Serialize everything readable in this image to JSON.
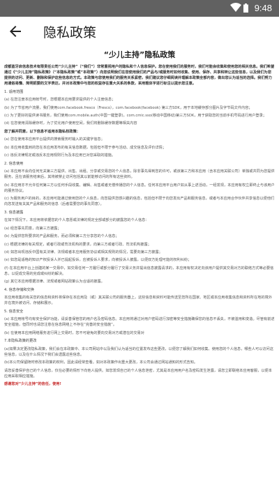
{
  "status_bar": {
    "time": "9:48"
  },
  "app_bar": {
    "title": "隐私政策"
  },
  "document": {
    "title": "“少儿主持”隐私政策",
    "paragraphs": [
      {
        "style": "bold",
        "text": "成都蓝牙启信息技术有限责任公司“少儿主持”（“我们”）非常重视用户的隐私和个人信息保护。您在使用我们的服务时，我们可能会收集和使用您的相关信息。我们希望通过《“少儿主持”隐私政策》（“本隐私政策”或“本政策”）向您说明我们在您使用我们的产品与/或服务时如何收集、使用、保存、共享和转让这些信息，以及我们为您提供的访问、更新、删除和保护这些信息的方式。本政策与您使用我们的服务关系紧密，我们建议您仔细阅读并理解本政策全部内容，做出您认为适当的选择。我们努力用通俗易懂、简明扼要的文字表达，并对本政策中与您的权益存在重大关系的条款，采用粗体字进行标注以提示您注意。"
      },
      {
        "style": "heading",
        "text": "1. 适用范围"
      },
      {
        "style": "normal",
        "text": "(a) 在您注册本应用帐号时，您根据本应用要求提供的个人注册信息；"
      },
      {
        "style": "normal",
        "text": "(b) 为了节省用户流量，我们使用com.facebook.fresco（Fresco），com.facebook(facebook) 第三方SDK，用于本地缓存部分图片及字节码文件内容；"
      },
      {
        "style": "normal",
        "text": "(c) 为了更好的提供读书服务，我们使用com.mobile.auth(中国一键登录)，com.cmic.sso(移动中国移动)第三方SDK，用于获取您的当前手机号码进行用户登录；"
      },
      {
        "style": "normal",
        "text": "(d) 在您使用清除缓存时，为了优化用户使用空间，我们将删除缓存数据等相关内容"
      },
      {
        "style": "bold",
        "text": "您了解并同意，以下信息不适用本隐私权政策："
      },
      {
        "style": "normal",
        "text": "(a) 您在使用本应用平台提供的搜索服务时输入的关键字信息；"
      },
      {
        "style": "normal",
        "text": "(b) 本应用收集到的您在本应用发布的有关信息数据，包括但不限于参与活动、成交信息及评价详情；"
      },
      {
        "style": "normal",
        "text": "(c) 违反法律规定或违反本应用规则行为及本应用已对您采取的措施。"
      },
      {
        "style": "heading",
        "text": "2. 信息使用"
      },
      {
        "style": "normal",
        "text": "(a) 本应用不会向任何无关第三方提供、出售、出租、分享或交易您的个人信息，除非事先得到您的许可，或该第三方和本应用（含本应用关联公司）单独或共同为您提供服务，且在该服务结束后，其将被禁止访问包括其以前能够访问的所有这些资料。"
      },
      {
        "style": "normal",
        "text": "(b) 本应用亦不允许任何第三方以任何手段收集、编辑、出售或者无偿传播您的个人信息。任何本应用平台用户如从事上述活动，一经发现，本应用有权立即终止与该用户的服务协议。"
      },
      {
        "style": "normal",
        "text": "(c) 为服务用户的目的，本应用可能通过使用您的个人信息，向您提供您感兴趣的信息，包括但不限于向您发出产品和服务信息，或者与本应用合作伙伴共享信息以便他们向您发送有关其产品和服务的信息（后者需要您的事先同意）。"
      },
      {
        "style": "heading",
        "text": "3. 信息披露"
      },
      {
        "style": "normal",
        "text": "在如下情况下，本应用将依据您的个人意愿或法律的规定全部或部分的披露您的个人信息："
      },
      {
        "style": "normal",
        "text": "(a) 经您事先同意，向第三方披露；"
      },
      {
        "style": "normal",
        "text": "(b) 为提供您所要求的产品和服务，而必须和第三方分享您的个人信息；"
      },
      {
        "style": "normal",
        "text": "(c) 根据法律的有关规定，或者行政或司法机构的要求，向第三方或者行政、司法机构披露；"
      },
      {
        "style": "normal",
        "text": "(d) 如您出现违反中国有关法律、法规或者本应用服务协议或相关规则的情况，需要向第三方披露；"
      },
      {
        "style": "normal",
        "text": "(e) 如您是适格的知识产权投诉人并已提起投诉，应被投诉人要求，向被投诉人披露，以便双方处理可能的权利纠纷；"
      },
      {
        "style": "normal",
        "text": "(f) 在本应用平台上创建的某一交易中，如交易任何一方履行或部分履行了交易义务并提出信息披露请求的，本应用有权决定向该用户提供其交易对方的联络方式等必要信息，以促成交易的完成或纠纷的解决。"
      },
      {
        "style": "normal",
        "text": "(g) 其它本应用根据法律、法规或者网站政策认为合适的披露。"
      },
      {
        "style": "heading",
        "text": "4. 信息存储和交换"
      },
      {
        "style": "normal",
        "text": "本应用收集的有关您的信息和资料将保存在本应用及（或）其关联公司的服务器上，这些信息和资料可能传送至您所在国家、地区或本应用收集信息和资料所在地的境外并在境外被访问、存储和展示。"
      },
      {
        "style": "heading",
        "text": "5. 信息安全"
      },
      {
        "style": "normal",
        "text": "(a) 本应用帐号均有安全保护功能，请妥善保管您的用户名及密码信息。本应用将通过对用户密码进行加密等安全措施确保您的信息不丢失，不被滥用和变造。尽管有前述安全措施，但同时也请您注意在信息网络上不存在“完善的安全措施”。"
      },
      {
        "style": "normal",
        "text": "(b) 在使用本应用网络服务进行网上交易时，您不可避免的要向交易对方或潜在的交易对"
      },
      {
        "style": "heading",
        "text": "7.本隐私政策的更改"
      },
      {
        "style": "normal",
        "text": "(a)如果决定更改隐私政策，我们会在本政策中、本公司网站中以及我们认为适当的位置发布这些更改，以便您了解我们如何收集、使用您的个人信息，哪些人可以访问这些信息，以及在什么情况下我们会透露这些信息。"
      },
      {
        "style": "normal",
        "text": "(b)本公司保留随时修改本政策的权利，因此请经常查看。如对本政策作出重大更改，本公司会通过网站通知的形式告知。"
      },
      {
        "style": "normal",
        "text": "请您妥善保护自己的个人信息，仅在必要的情形下向他人提供。如您发现自己的个人信息泄密，尤其是本应用用户名及密码发生泄露，请您立即联络本应用客服，以便本应用采取相应措施。"
      },
      {
        "style": "red",
        "text": "感谢您对“少儿主持”的信任，使用!"
      }
    ]
  }
}
